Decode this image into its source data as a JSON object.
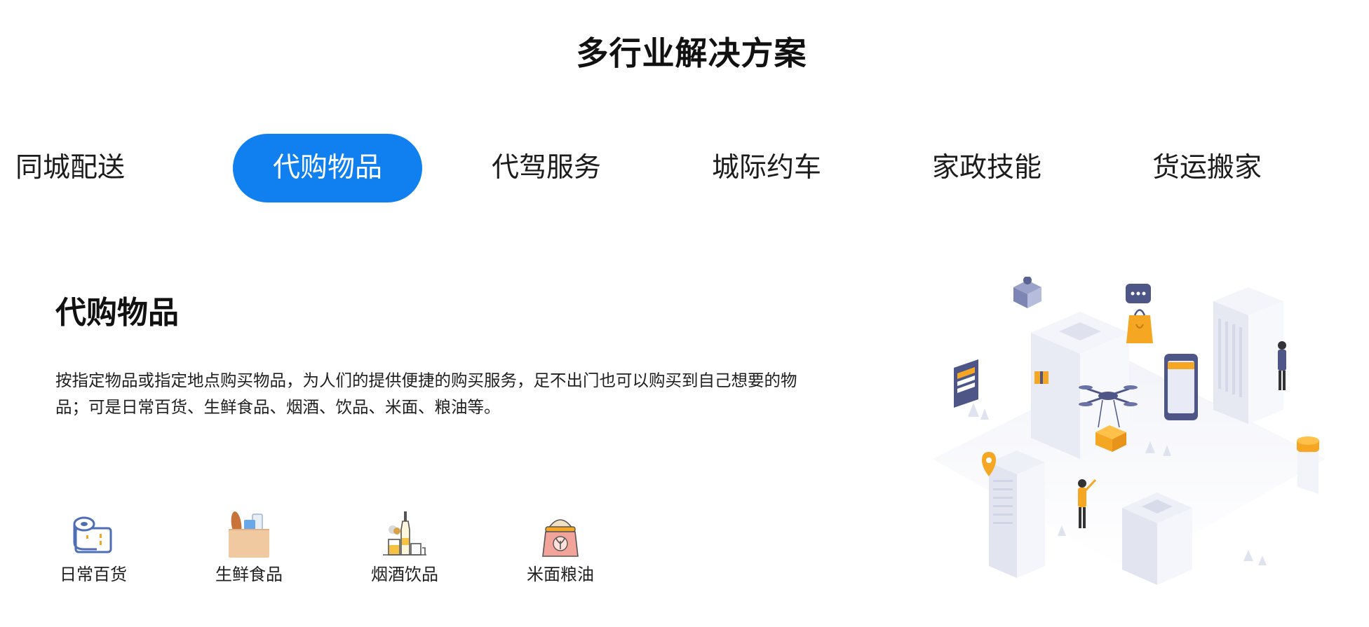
{
  "page": {
    "title": "多行业解决方案"
  },
  "tabs": [
    {
      "label": "同城配送",
      "active": false
    },
    {
      "label": "代购物品",
      "active": true
    },
    {
      "label": "代驾服务",
      "active": false
    },
    {
      "label": "城际约车",
      "active": false
    },
    {
      "label": "家政技能",
      "active": false
    },
    {
      "label": "货运搬家",
      "active": false
    }
  ],
  "content": {
    "heading": "代购物品",
    "description": "按指定物品或指定地点购买物品，为人们的提供便捷的购买服务，足不出门也可以购买到自己想要的物品；可是日常百货、生鲜食品、烟酒、饮品、米面、粮油等。"
  },
  "categories": [
    {
      "label": "日常百货",
      "icon": "toilet-paper-icon"
    },
    {
      "label": "生鲜食品",
      "icon": "grocery-bag-icon"
    },
    {
      "label": "烟酒饮品",
      "icon": "liquor-bottles-icon"
    },
    {
      "label": "米面粮油",
      "icon": "rice-sack-icon"
    }
  ],
  "hero": {
    "icon": "isometric-city-delivery-illustration"
  },
  "colors": {
    "accent": "#1080f0",
    "illustration_primary": "#f5a623",
    "illustration_secondary": "#5b6391",
    "building": "#eef0f7"
  }
}
